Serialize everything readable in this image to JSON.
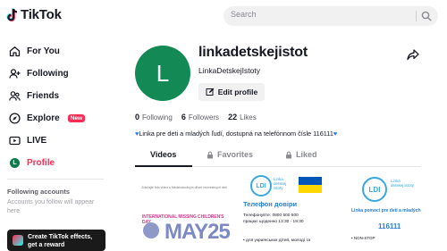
{
  "app": {
    "brand": "TikTok"
  },
  "search": {
    "placeholder": "Search"
  },
  "sidebar": {
    "items": [
      {
        "label": "For You",
        "icon": "home-icon"
      },
      {
        "label": "Following",
        "icon": "following-icon"
      },
      {
        "label": "Friends",
        "icon": "friends-icon"
      },
      {
        "label": "Explore",
        "icon": "compass-icon",
        "badge": "New"
      },
      {
        "label": "LIVE",
        "icon": "live-icon"
      },
      {
        "label": "Profile",
        "icon": "profile-icon",
        "avatar_letter": "L",
        "active": true
      }
    ],
    "following_title": "Following accounts",
    "following_sub": "Accounts you follow will appear here",
    "effects_text": "Create TikTok effects, get a reward"
  },
  "profile": {
    "avatar_letter": "L",
    "username": "linkadetskejistot",
    "nickname": "LinkaDetskejIstoty",
    "edit_label": "Edit profile",
    "following_count": "0",
    "following_label": "Following",
    "followers_count": "6",
    "followers_label": "Followers",
    "likes_count": "22",
    "likes_label": "Likes",
    "bio": "Linka pre deti a mladých ľudí, dostupná na telefónnom čísle 116111"
  },
  "tabs": [
    {
      "label": "Videos",
      "active": true
    },
    {
      "label": "Favorites"
    },
    {
      "label": "Liked"
    }
  ],
  "videos": {
    "v1": {
      "small": "Zdieľajte toto video s Medzinárodným dňom nezvestných detí",
      "banner": "INTERNATIONAL MISSING CHILDREN'S DAY",
      "big": "MAY25"
    },
    "v2": {
      "ldi": "LDI",
      "ldi_label": "Linka detskej istoty",
      "title": "Телефон довіри",
      "line1": "Телефонуйте: 0800 500 500",
      "line2": "працює щоденно 13:30 - 19:30",
      "line3": "• для українських дітей, молоді та"
    },
    "v3": {
      "ldi": "LDI",
      "ldi_label": "Linka detskej istoty",
      "title": "Linka pomoci pre deti a mladých",
      "number": "116111",
      "line1": "• NON-STOP"
    }
  },
  "colors": {
    "accent": "#fe2c55",
    "avatar_bg": "#138a55",
    "ldi_blue": "#39a8e0"
  }
}
